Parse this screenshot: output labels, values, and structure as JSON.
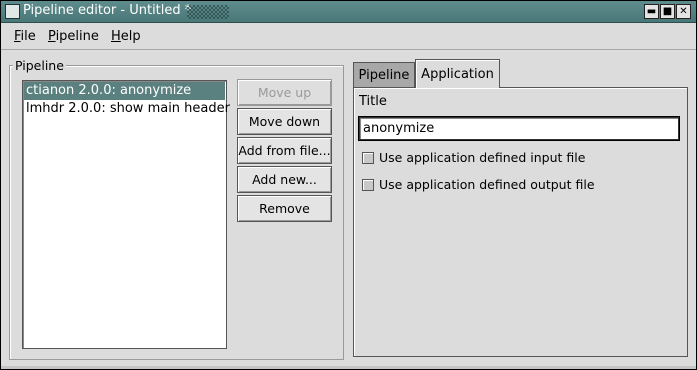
{
  "window": {
    "title": "Pipeline editor - Untitled *",
    "minimize_glyph": "▬",
    "maximize_glyph": "■",
    "close_glyph": "✕"
  },
  "menubar": {
    "items": [
      {
        "accel": "F",
        "rest": "ile"
      },
      {
        "accel": "P",
        "rest": "ipeline"
      },
      {
        "accel": "H",
        "rest": "elp"
      }
    ]
  },
  "pipeline_group": {
    "label": "Pipeline",
    "items": [
      {
        "label": "ctianon 2.0.0: anonymize",
        "selected": true
      },
      {
        "label": "lmhdr 2.0.0: show main header",
        "selected": false
      }
    ],
    "buttons": {
      "move_up": "Move up",
      "move_down": "Move down",
      "add_from_file": "Add from file...",
      "add_new": "Add new...",
      "remove": "Remove"
    }
  },
  "tabs": [
    {
      "label": "Pipeline",
      "active": false
    },
    {
      "label": "Application",
      "active": true
    }
  ],
  "application_tab": {
    "title_label": "Title",
    "title_value": "anonymize",
    "input_file_label": "Use application defined input file",
    "input_file_checked": false,
    "output_file_label": "Use application defined output file",
    "output_file_checked": false
  },
  "colors": {
    "titlebar": "#5f8c8c",
    "selection": "#5b8080",
    "window_bg": "#dcdcdc"
  }
}
